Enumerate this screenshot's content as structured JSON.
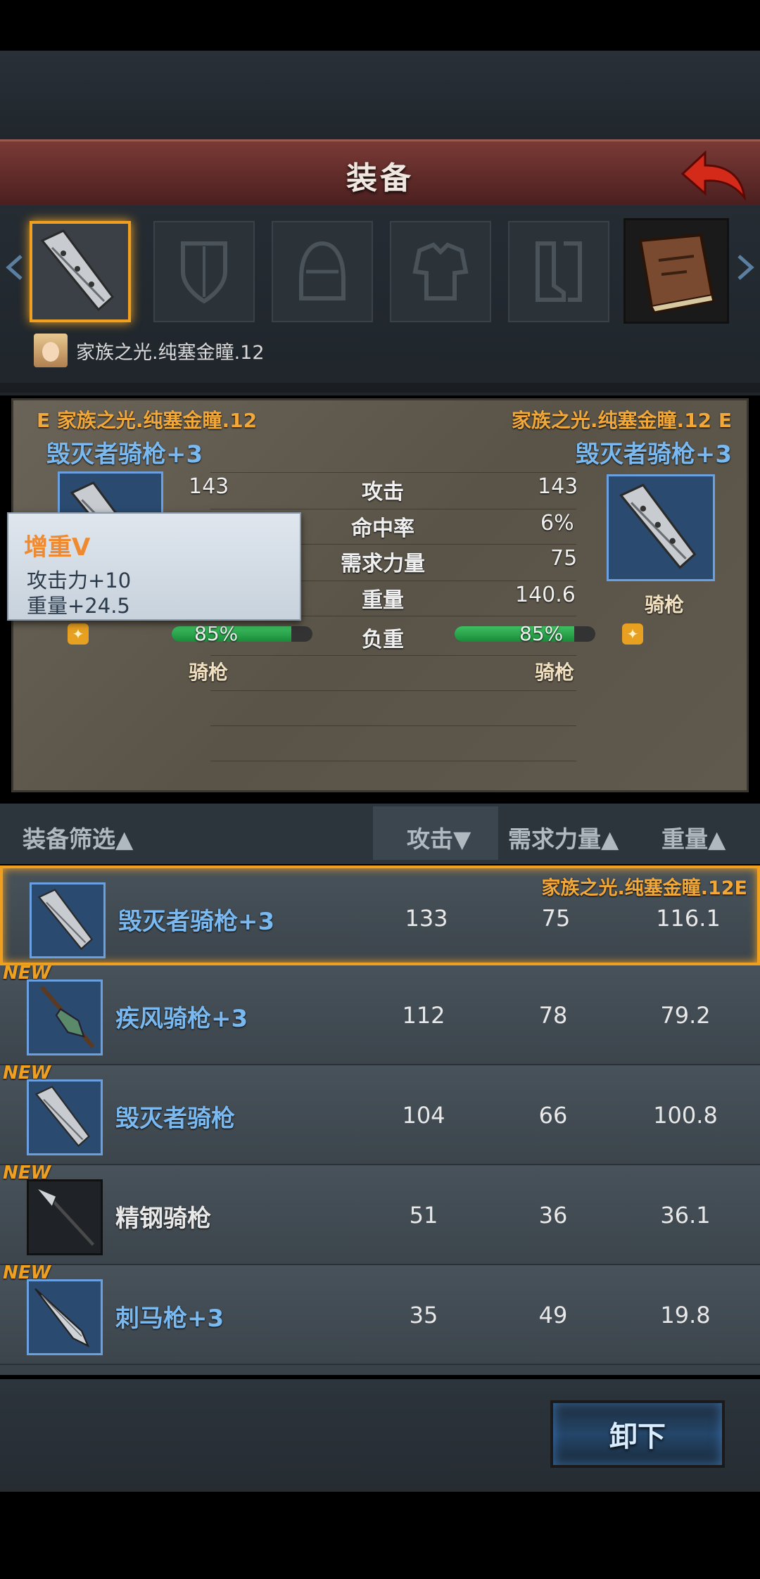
{
  "header": {
    "title": "装备"
  },
  "owner": {
    "name": "家族之光.纯塞金瞳.12"
  },
  "slots": [
    {
      "name": "lance-slot",
      "active": true
    },
    {
      "name": "shield-slot"
    },
    {
      "name": "helmet-slot"
    },
    {
      "name": "armor-slot"
    },
    {
      "name": "boots-slot"
    },
    {
      "name": "book-slot"
    }
  ],
  "compare": {
    "left": {
      "owner": "E 家族之光.纯塞金瞳.12",
      "item": "毁灭者骑枪+3",
      "attack": "143",
      "load": "85%",
      "type": "骑枪"
    },
    "right": {
      "owner": "家族之光.纯塞金瞳.12 E",
      "item": "毁灭者骑枪+3",
      "attack": "143",
      "hit": "6%",
      "str": "75",
      "weight": "140.6",
      "load": "85%",
      "type": "骑枪",
      "icon_label": "骑枪"
    },
    "labels": {
      "attack": "攻击",
      "hit": "命中率",
      "str": "需求力量",
      "weight": "重量",
      "load": "负重"
    },
    "load_fraction": 0.85
  },
  "tooltip": {
    "title": "增重V",
    "line1": "攻击力+10",
    "line2": "重量+24.5"
  },
  "list_header": {
    "filter": "装备筛选▲",
    "attack": "攻击▼",
    "str": "需求力量▲",
    "weight": "重量▲"
  },
  "items": [
    {
      "name": "毁灭者骑枪+3",
      "attack": "133",
      "str": "75",
      "weight": "116.1",
      "owner": "家族之光.纯塞金瞳.12E",
      "new": "",
      "selected": true,
      "rare": true
    },
    {
      "name": "疾风骑枪+3",
      "attack": "112",
      "str": "78",
      "weight": "79.2",
      "owner": "",
      "new": "NEW",
      "rare": true
    },
    {
      "name": "毁灭者骑枪",
      "attack": "104",
      "str": "66",
      "weight": "100.8",
      "owner": "",
      "new": "NEW",
      "rare": true
    },
    {
      "name": "精钢骑枪",
      "attack": "51",
      "str": "36",
      "weight": "36.1",
      "owner": "",
      "new": "NEW",
      "rare": false
    },
    {
      "name": "刺马枪+3",
      "attack": "35",
      "str": "49",
      "weight": "19.8",
      "owner": "",
      "new": "NEW",
      "rare": true
    }
  ],
  "actions": {
    "unequip": "卸下"
  },
  "colors": {
    "accent": "#f0a020",
    "rare_name": "#7ab8f0",
    "title_bar": "#6a302c"
  }
}
